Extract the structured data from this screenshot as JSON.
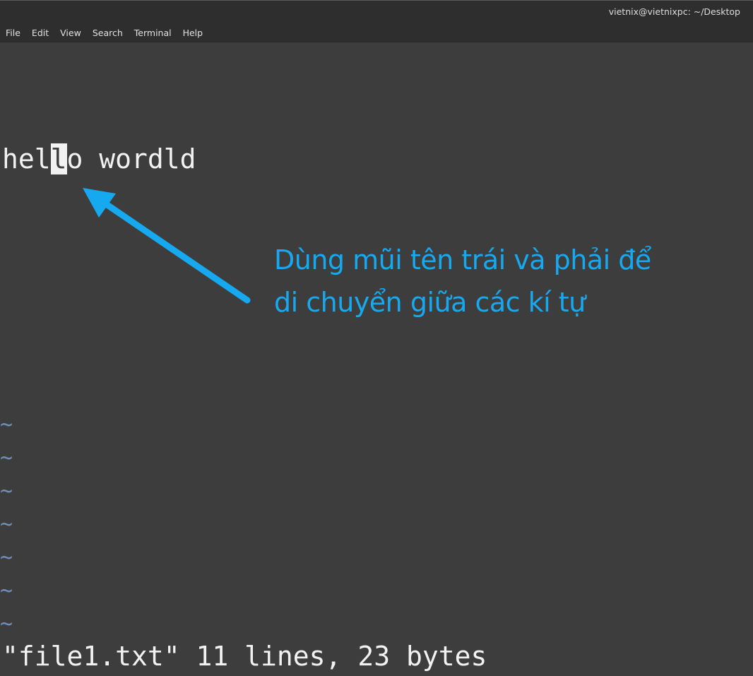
{
  "window": {
    "title": "vietnix@vietnixpc: ~/Desktop"
  },
  "menubar": {
    "items": [
      "File",
      "Edit",
      "View",
      "Search",
      "Terminal",
      "Help"
    ]
  },
  "buffer": {
    "before_cursor": "hel",
    "cursor_char": "l",
    "after_cursor": "o wordld"
  },
  "empty_line_marker": "~",
  "status_line": "\"file1.txt\" 11 lines, 23 bytes",
  "annotation": {
    "line1": "Dùng mũi tên trái và phải để",
    "line2": "di chuyển giữa các kí tự",
    "color": "#17a9f0",
    "arrow_icon": "arrow-up-left-icon"
  }
}
